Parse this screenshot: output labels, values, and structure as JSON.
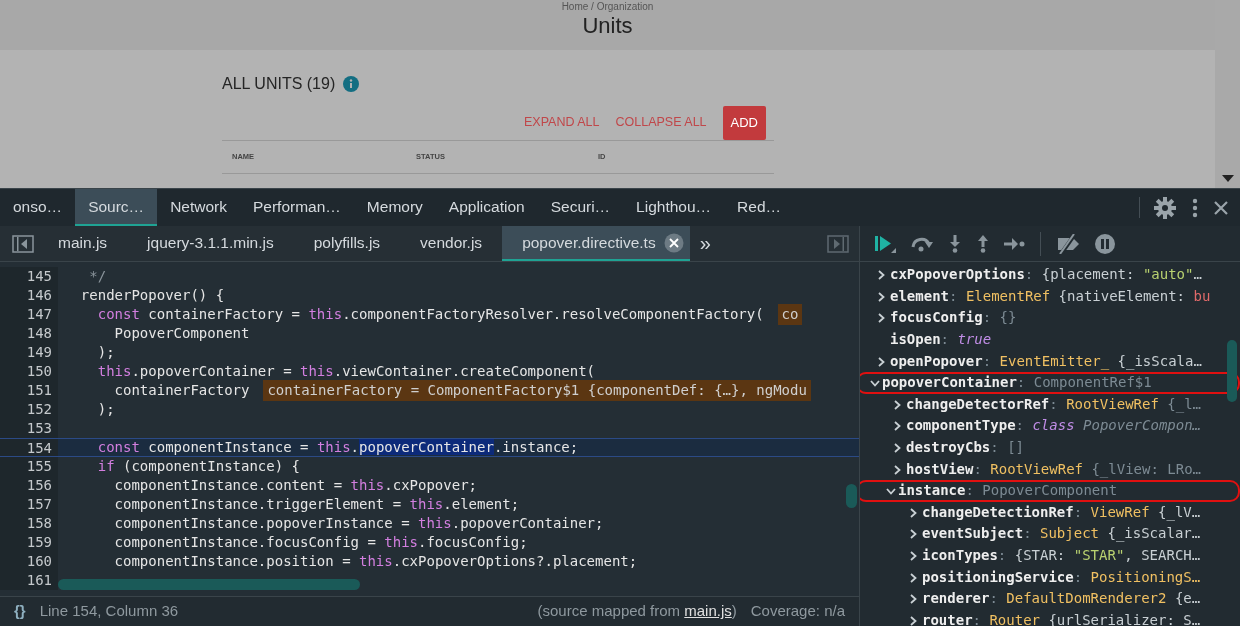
{
  "page": {
    "breadcrumb": "Home / Organization",
    "title": "Units",
    "section_title": "ALL UNITS (19)",
    "actions": [
      {
        "label": "EXPAND ALL",
        "kind": "link"
      },
      {
        "label": "COLLAPSE ALL",
        "kind": "link"
      },
      {
        "label": "ADD",
        "kind": "primary"
      }
    ],
    "columns": [
      "NAME",
      "STATUS",
      "ID"
    ]
  },
  "devtools": {
    "tabs": [
      {
        "label": "onso…",
        "selected": false
      },
      {
        "label": "Sourc…",
        "selected": true
      },
      {
        "label": "Network",
        "selected": false
      },
      {
        "label": "Performan…",
        "selected": false
      },
      {
        "label": "Memory",
        "selected": false
      },
      {
        "label": "Application",
        "selected": false
      },
      {
        "label": "Securi…",
        "selected": false
      },
      {
        "label": "Lighthou…",
        "selected": false
      },
      {
        "label": "Red…",
        "selected": false
      }
    ],
    "files": [
      {
        "label": "main.js",
        "selected": false,
        "closable": false
      },
      {
        "label": "jquery-3.1.1.min.js",
        "selected": false,
        "closable": false
      },
      {
        "label": "polyfills.js",
        "selected": false,
        "closable": false
      },
      {
        "label": "vendor.js",
        "selected": false,
        "closable": false
      },
      {
        "label": "popover.directive.ts",
        "selected": true,
        "closable": true
      }
    ],
    "more": "»",
    "code": [
      {
        "number": "145",
        "current": false,
        "segments": [
          {
            "kind": "comment",
            "text": "   */"
          }
        ]
      },
      {
        "number": "146",
        "current": false,
        "segments": [
          {
            "kind": "plain",
            "text": "  renderPopover() {"
          }
        ]
      },
      {
        "number": "147",
        "current": false,
        "segments": [
          {
            "kind": "kw",
            "text": "    const"
          },
          {
            "kind": "plain",
            "text": " containerFactory = "
          },
          {
            "kind": "kw",
            "text": "this"
          },
          {
            "kind": "plain",
            "text": ".componentFactoryResolver.resolveComponentFactory("
          }
        ],
        "inline": "co"
      },
      {
        "number": "148",
        "current": false,
        "segments": [
          {
            "kind": "plain",
            "text": "      PopoverComponent"
          }
        ]
      },
      {
        "number": "149",
        "current": false,
        "segments": [
          {
            "kind": "plain",
            "text": "    );"
          }
        ]
      },
      {
        "number": "150",
        "current": false,
        "segments": [
          {
            "kind": "kw",
            "text": "    this"
          },
          {
            "kind": "plain",
            "text": ".popoverContainer = "
          },
          {
            "kind": "kw",
            "text": "this"
          },
          {
            "kind": "plain",
            "text": ".viewContainer.createComponent("
          }
        ]
      },
      {
        "number": "151",
        "current": false,
        "segments": [
          {
            "kind": "plain",
            "text": "      containerFactory"
          }
        ],
        "inline": "containerFactory = ComponentFactory$1 {componentDef: {…}, ngModu"
      },
      {
        "number": "152",
        "current": false,
        "segments": [
          {
            "kind": "plain",
            "text": "    );"
          }
        ]
      },
      {
        "number": "153",
        "current": false
      },
      {
        "number": "154",
        "current": true,
        "segments": [
          {
            "kind": "kw",
            "text": "    const"
          },
          {
            "kind": "plain",
            "text": " componentInstance = "
          },
          {
            "kind": "kw",
            "text": "this"
          },
          {
            "kind": "plain",
            "text": "."
          },
          {
            "kind": "sel",
            "text": "popoverContainer"
          },
          {
            "kind": "plain",
            "text": ".instance;"
          }
        ]
      },
      {
        "number": "155",
        "current": false,
        "segments": [
          {
            "kind": "kw",
            "text": "    if"
          },
          {
            "kind": "plain",
            "text": " (componentInstance) {"
          }
        ]
      },
      {
        "number": "156",
        "current": false,
        "segments": [
          {
            "kind": "plain",
            "text": "      componentInstance.content = "
          },
          {
            "kind": "kw",
            "text": "this"
          },
          {
            "kind": "plain",
            "text": ".cxPopover;"
          }
        ]
      },
      {
        "number": "157",
        "current": false,
        "segments": [
          {
            "kind": "plain",
            "text": "      componentInstance.triggerElement = "
          },
          {
            "kind": "kw",
            "text": "this"
          },
          {
            "kind": "plain",
            "text": ".element;"
          }
        ]
      },
      {
        "number": "158",
        "current": false,
        "segments": [
          {
            "kind": "plain",
            "text": "      componentInstance.popoverInstance = "
          },
          {
            "kind": "kw",
            "text": "this"
          },
          {
            "kind": "plain",
            "text": ".popoverContainer;"
          }
        ]
      },
      {
        "number": "159",
        "current": false,
        "segments": [
          {
            "kind": "plain",
            "text": "      componentInstance.focusConfig = "
          },
          {
            "kind": "kw",
            "text": "this"
          },
          {
            "kind": "plain",
            "text": ".focusConfig;"
          }
        ]
      },
      {
        "number": "160",
        "current": false,
        "segments": [
          {
            "kind": "plain",
            "text": "      componentInstance.position = "
          },
          {
            "kind": "kw",
            "text": "this"
          },
          {
            "kind": "plain",
            "text": ".cxPopoverOptions?.placement;"
          }
        ]
      },
      {
        "number": "161",
        "current": false
      }
    ],
    "status": {
      "braces": "{}",
      "position": "Line 154, Column 36",
      "source_prefix": "(source mapped from ",
      "source_link": "main.js",
      "source_suffix": ")",
      "coverage": "Coverage: n/a"
    },
    "scope": [
      {
        "name": "cxPopoverOptions",
        "expanded": false,
        "circled": false,
        "value": [
          {
            "kind": "dim",
            "text": ": "
          },
          {
            "kind": "plain",
            "text": "{placement: "
          },
          {
            "kind": "string",
            "text": "\"auto\""
          },
          {
            "kind": "plain",
            "text": "…"
          }
        ]
      },
      {
        "name": "element",
        "expanded": false,
        "circled": false,
        "value": [
          {
            "kind": "dim",
            "text": ": "
          },
          {
            "kind": "type",
            "text": "ElementRef"
          },
          {
            "kind": "plain",
            "text": " {nativeElement: "
          },
          {
            "kind": "error",
            "text": "bu"
          }
        ]
      },
      {
        "name": "focusConfig",
        "expanded": false,
        "circled": false,
        "value": [
          {
            "kind": "dim",
            "text": ": {}"
          }
        ]
      },
      {
        "name": "isOpen",
        "circled": false,
        "value": [
          {
            "kind": "dim",
            "text": ": "
          },
          {
            "kind": "keyword",
            "text": "true"
          }
        ]
      },
      {
        "name": "openPopover",
        "expanded": false,
        "circled": false,
        "value": [
          {
            "kind": "dim",
            "text": ": "
          },
          {
            "kind": "type",
            "text": "EventEmitter_"
          },
          {
            "kind": "plain",
            "text": " {_isScala…"
          }
        ]
      },
      {
        "name": "popoverContainer",
        "expanded": true,
        "circled": true,
        "value": [
          {
            "kind": "dim",
            "text": ": ComponentRef$1"
          }
        ],
        "children": [
          {
            "name": "changeDetectorRef",
            "expanded": false,
            "circled": false,
            "value": [
              {
                "kind": "dim",
                "text": ": "
              },
              {
                "kind": "type",
                "text": "RootViewRef"
              },
              {
                "kind": "dim",
                "text": " {_l…"
              }
            ]
          },
          {
            "name": "componentType",
            "expanded": false,
            "circled": false,
            "value": [
              {
                "kind": "dim",
                "text": ": "
              },
              {
                "kind": "keyword",
                "text": "class"
              },
              {
                "kind": "dimitalic",
                "text": " PopoverCompon…"
              }
            ]
          },
          {
            "name": "destroyCbs",
            "expanded": false,
            "circled": false,
            "value": [
              {
                "kind": "dim",
                "text": ": []"
              }
            ]
          },
          {
            "name": "hostView",
            "expanded": false,
            "circled": false,
            "value": [
              {
                "kind": "dim",
                "text": ": "
              },
              {
                "kind": "type",
                "text": "RootViewRef"
              },
              {
                "kind": "dim",
                "text": " {_lView: LRo…"
              }
            ]
          },
          {
            "name": "instance",
            "expanded": true,
            "circled": true,
            "value": [
              {
                "kind": "dim",
                "text": ": PopoverComponent"
              }
            ],
            "children": [
              {
                "name": "changeDetectionRef",
                "expanded": false,
                "circled": false,
                "value": [
                  {
                    "kind": "dim",
                    "text": ": "
                  },
                  {
                    "kind": "type",
                    "text": "ViewRef"
                  },
                  {
                    "kind": "plain",
                    "text": " {_lV…"
                  }
                ]
              },
              {
                "name": "eventSubject",
                "expanded": false,
                "circled": false,
                "value": [
                  {
                    "kind": "dim",
                    "text": ": "
                  },
                  {
                    "kind": "type",
                    "text": "Subject"
                  },
                  {
                    "kind": "plain",
                    "text": " {_isScalar…"
                  }
                ]
              },
              {
                "name": "iconTypes",
                "expanded": false,
                "circled": false,
                "value": [
                  {
                    "kind": "dim",
                    "text": ": "
                  },
                  {
                    "kind": "plain",
                    "text": "{STAR: "
                  },
                  {
                    "kind": "string",
                    "text": "\"STAR\""
                  },
                  {
                    "kind": "plain",
                    "text": ", SEARCH…"
                  }
                ]
              },
              {
                "name": "positioningService",
                "expanded": false,
                "circled": false,
                "value": [
                  {
                    "kind": "dim",
                    "text": ": "
                  },
                  {
                    "kind": "type",
                    "text": "PositioningS…"
                  }
                ]
              },
              {
                "name": "renderer",
                "expanded": false,
                "circled": false,
                "value": [
                  {
                    "kind": "dim",
                    "text": ": "
                  },
                  {
                    "kind": "type",
                    "text": "DefaultDomRenderer2"
                  },
                  {
                    "kind": "plain",
                    "text": " {e…"
                  }
                ]
              },
              {
                "name": "router",
                "expanded": false,
                "circled": false,
                "value": [
                  {
                    "kind": "dim",
                    "text": ": "
                  },
                  {
                    "kind": "type",
                    "text": "Router"
                  },
                  {
                    "kind": "plain",
                    "text": " {urlSerializer: S…"
                  }
                ]
              }
            ]
          }
        ]
      }
    ]
  }
}
